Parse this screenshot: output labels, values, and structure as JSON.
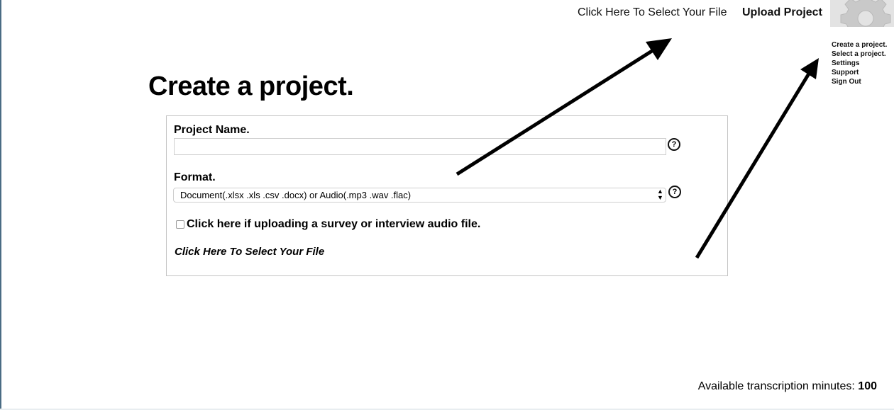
{
  "nav": {
    "select_file": "Click Here To Select Your File",
    "upload_project": "Upload Project",
    "settings_icon": "gear-icon"
  },
  "side_menu": {
    "items": [
      "Create a project.",
      "Select a project.",
      "Settings",
      "Support",
      "Sign Out"
    ]
  },
  "page": {
    "title": "Create a project."
  },
  "form": {
    "project_name_label": "Project Name.",
    "project_name_value": "",
    "format_label": "Format.",
    "format_selected": "Document(.xlsx .xls .csv .docx) or Audio(.mp3 .wav .flac)",
    "help_icon": "question-circle-icon",
    "help_glyph": "?",
    "audio_checkbox_checked": false,
    "audio_checkbox_label": "Click here if uploading a survey or interview audio file.",
    "select_file_link": "Click Here To Select Your File"
  },
  "footer": {
    "minutes_label": "Available transcription minutes:",
    "minutes_value": "100"
  },
  "colors": {
    "annotation_arrow": "#000000",
    "gear_background": "#e3e3e3",
    "border": "#c4c4c4"
  }
}
